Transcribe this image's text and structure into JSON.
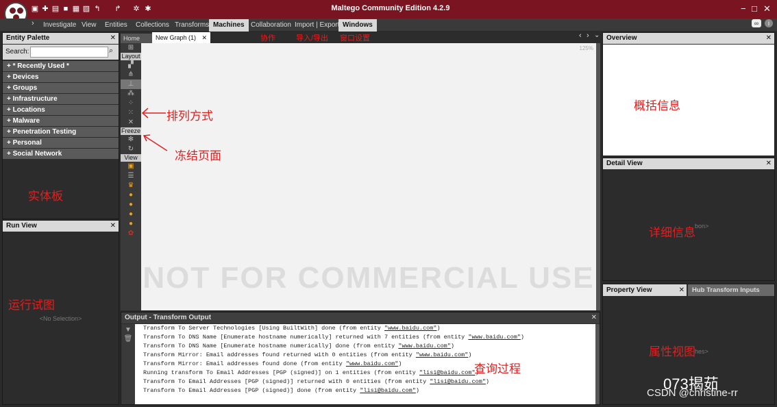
{
  "app": {
    "title": "Maltego Community Edition 4.2.9"
  },
  "window": {
    "minimize": "−",
    "maximize": "□",
    "close": "✕"
  },
  "menus": [
    "Investigate",
    "View",
    "Entities",
    "Collections",
    "Transforms",
    "Machines",
    "Collaboration",
    "Import | Export",
    "Windows"
  ],
  "tabs": {
    "home": "Home",
    "graph": "New Graph (1)"
  },
  "zoom": "125%",
  "watermark": "NOT FOR COMMERCIAL USE",
  "entity_palette": {
    "title": "Entity Palette",
    "search_label": "Search:",
    "items": [
      "* Recently Used *",
      "Devices",
      "Groups",
      "Infrastructure",
      "Locations",
      "Malware",
      "Penetration Testing",
      "Personal",
      "Social Network"
    ]
  },
  "run_view": {
    "title": "Run View",
    "empty": "<No Selection>"
  },
  "toolbar": {
    "layout": "Layout",
    "freeze": "Freeze",
    "view": "View"
  },
  "overview": {
    "title": "Overview"
  },
  "detail_view": {
    "title": "Detail View",
    "hidden_text": "bon>"
  },
  "property_view": {
    "title": "Property View",
    "hub_tab": "Hub Transform Inputs",
    "hidden_text": "hes>"
  },
  "output": {
    "title": "Output - Transform Output",
    "lines": [
      {
        "text": "Transform To Server Technologies [Using BuiltWith] done (from entity ",
        "entity": "\"www.baidu.com\"",
        "end": ")"
      },
      {
        "text": "Transform To DNS Name [Enumerate hostname numerically] returned with 7 entities (from entity ",
        "entity": "\"www.baidu.com\"",
        "end": ")"
      },
      {
        "text": "Transform To DNS Name [Enumerate hostname numerically] done (from entity ",
        "entity": "\"www.baidu.com\"",
        "end": ")"
      },
      {
        "text": "Transform Mirror: Email addresses found returned with 0 entities (from entity ",
        "entity": "\"www.baidu.com\"",
        "end": ")"
      },
      {
        "text": "Transform Mirror: Email addresses found done (from entity ",
        "entity": "\"www.baidu.com\"",
        "end": ")"
      },
      {
        "text": "Running transform To Email Addresses [PGP (signed)] on 1 entities (from entity ",
        "entity": "\"lisi@baidu.com\"",
        "end": ")"
      },
      {
        "text": "Transform To Email Addresses [PGP (signed)] returned with 0 entities (from entity ",
        "entity": "\"lisi@baidu.com\"",
        "end": ")"
      },
      {
        "text": "Transform To Email Addresses [PGP (signed)] done (from entity ",
        "entity": "\"lisi@baidu.com\"",
        "end": ")"
      }
    ]
  },
  "annotations": {
    "collab": "协作",
    "import_export": "导入/导出",
    "window_settings": "窗口设置",
    "layout_mode": "排列方式",
    "freeze_page": "冻结页面",
    "entity_board": "实体板",
    "run_view": "运行试图",
    "overview": "概括信息",
    "detail": "详细信息",
    "property": "属性视图",
    "query": "查询过程"
  },
  "footer": {
    "brand": "073揭茹",
    "csdn": "CSDN @christine-rr"
  },
  "colors": {
    "titlebar": "#7a1420",
    "accent": "#e02020"
  }
}
